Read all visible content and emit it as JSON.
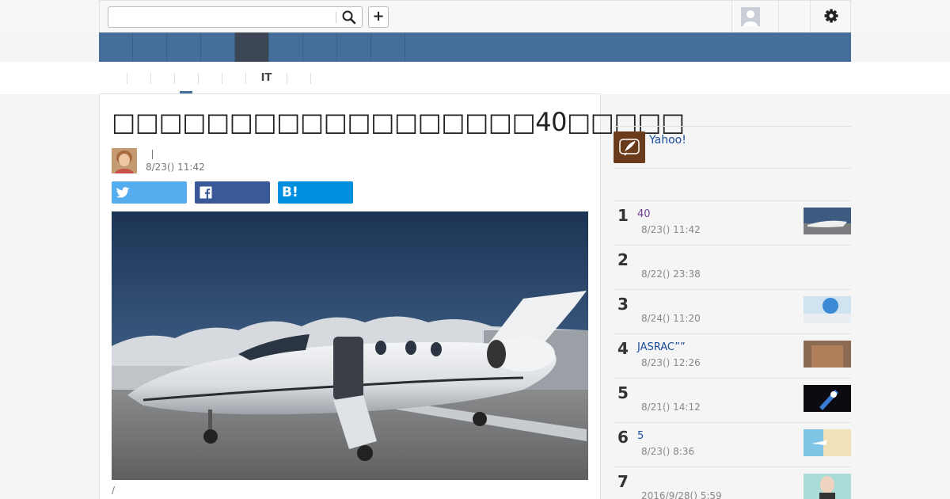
{
  "header": {
    "search_placeholder": "",
    "plus_label": "+"
  },
  "category_nav": [
    "",
    "",
    "",
    "",
    "",
    "",
    "",
    "",
    ""
  ],
  "sub_nav": [
    "",
    "",
    "",
    "",
    "",
    "IT",
    "",
    ""
  ],
  "article": {
    "title": "□□□□□□□□□□□□□□□□□□40□□□□□",
    "author_name": "",
    "published": "8/23() 11:42",
    "share_twitter": "",
    "share_facebook": "",
    "share_hatena": "B!",
    "caption": "/"
  },
  "sidebar": {
    "yahoo_label": "Yahoo!",
    "ranking": [
      {
        "rank": "1",
        "title": "40",
        "time": "8/23() 11:42",
        "visited": true
      },
      {
        "rank": "2",
        "title": "",
        "time": "8/22() 23:38",
        "visited": false
      },
      {
        "rank": "3",
        "title": "",
        "time": "8/24() 11:20",
        "visited": false
      },
      {
        "rank": "4",
        "title": "JASRAC””",
        "time": "8/23() 12:26",
        "visited": false
      },
      {
        "rank": "5",
        "title": "",
        "time": "8/21() 14:12",
        "visited": false
      },
      {
        "rank": "6",
        "title": "5",
        "time": "8/23() 8:36",
        "visited": false
      },
      {
        "rank": "7",
        "title": "",
        "time": "2016/9/28() 5:59",
        "visited": false
      }
    ]
  },
  "colors": {
    "nav_blue": "#456f9a",
    "nav_active": "#3c4655",
    "twitter": "#55acee",
    "facebook": "#3b5998",
    "hatena": "#008fde",
    "link": "#1a4c9c"
  }
}
